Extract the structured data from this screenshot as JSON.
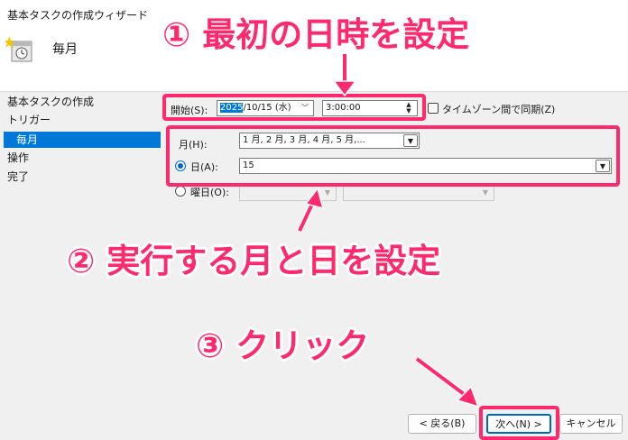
{
  "window": {
    "title": "基本タスクの作成ウィザード"
  },
  "header": {
    "title": "毎月"
  },
  "sidebar": {
    "items": [
      {
        "label": "基本タスクの作成"
      },
      {
        "label": "トリガー"
      },
      {
        "label": "毎月",
        "selected": true
      },
      {
        "label": "操作"
      },
      {
        "label": "完了"
      }
    ]
  },
  "form": {
    "start_label": "開始(S):",
    "start_date_year": "2025",
    "start_date_rest": "/10/15 (水)",
    "start_time": "3:00:00",
    "timezone_sync_label": "タイムゾーン間で同期(Z)",
    "timezone_sync_checked": false,
    "months_label": "月(H):",
    "months_value": "1 月, 2 月, 3 月, 4 月, 5 月,...",
    "days_label": "日(A):",
    "days_value": "15",
    "days_selected": true,
    "weekday_label": "曜日(O):",
    "weekday_selected": false
  },
  "buttons": {
    "back": "< 戻る(B)",
    "next": "次へ(N) >",
    "cancel": "キャンセル"
  },
  "annotations": {
    "step1": "① 最初の日時を設定",
    "step2": "② 実行する月と日を設定",
    "step3": "③ クリック",
    "color": "#ff2a6d"
  }
}
